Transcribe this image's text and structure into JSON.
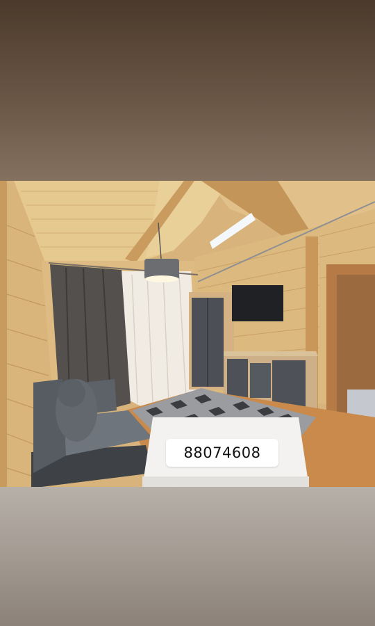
{
  "story": {
    "phone_sticker": "88074608",
    "photo_subject": "wooden-cabin-living-room",
    "colors": {
      "top_gradient": "#4b3a2b",
      "bottom_gradient": "#a39a92",
      "wood": "#d8b47c",
      "sofa": "#5c6268"
    }
  }
}
